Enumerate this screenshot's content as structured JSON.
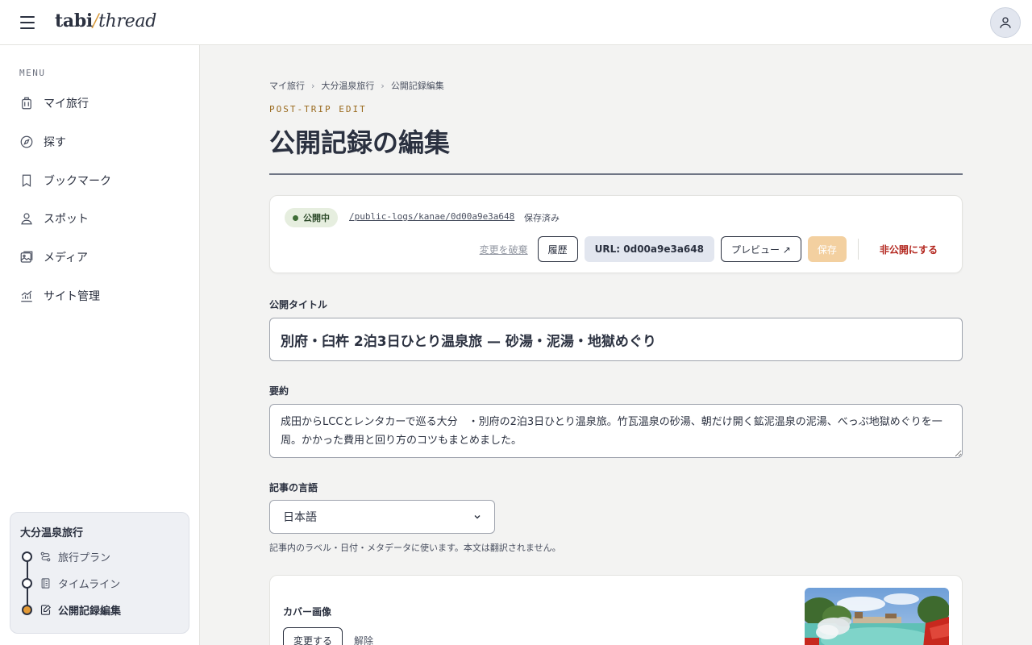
{
  "app": {
    "logo_primary": "tabi",
    "logo_slash": "/",
    "logo_secondary": "thread"
  },
  "sidebar": {
    "menu_heading": "MENU",
    "items": [
      {
        "label": "マイ旅行",
        "icon": "luggage-icon"
      },
      {
        "label": "探す",
        "icon": "compass-icon"
      },
      {
        "label": "ブックマーク",
        "icon": "bookmark-icon"
      },
      {
        "label": "スポット",
        "icon": "location-person-icon"
      },
      {
        "label": "メディア",
        "icon": "images-icon"
      },
      {
        "label": "サイト管理",
        "icon": "analytics-icon"
      }
    ],
    "trip": {
      "title": "大分温泉旅行",
      "steps": [
        {
          "label": "旅行プラン",
          "icon": "route-icon",
          "active": false
        },
        {
          "label": "タイムライン",
          "icon": "timeline-icon",
          "active": false
        },
        {
          "label": "公開記録編集",
          "icon": "edit-doc-icon",
          "active": true
        }
      ]
    }
  },
  "breadcrumb": [
    "マイ旅行",
    "大分温泉旅行",
    "公開記録編集"
  ],
  "breadcrumb_separator": "›",
  "header": {
    "eyebrow": "POST-TRIP EDIT",
    "title": "公開記録の編集"
  },
  "status": {
    "badge": "公開中",
    "url": "/public-logs/kanae/0d00a9e3a648",
    "saved_state": "保存済み",
    "discard_label": "変更を破棄",
    "history_label": "履歴",
    "url_button_label": "URL: 0d00a9e3a648",
    "preview_label": "プレビュー ↗",
    "save_label": "保存",
    "unpublish_label": "非公開にする"
  },
  "form": {
    "title_label": "公開タイトル",
    "title_value": "別府・臼杵 2泊3日ひとり温泉旅 — 砂湯・泥湯・地獄めぐり",
    "summary_label": "要約",
    "summary_value": "成田からLCCとレンタカーで巡る大分　・別府の2泊3日ひとり温泉旅。竹瓦温泉の砂湯、朝だけ開く鉱泥温泉の泥湯、べっぷ地獄めぐりを一周。かかった費用と回り方のコツもまとめました。",
    "language_label": "記事の言語",
    "language_value": "日本語",
    "language_help": "記事内のラベル・日付・メタデータに使います。本文は翻訳されません。"
  },
  "cover": {
    "label": "カバー画像",
    "change_label": "変更する",
    "remove_label": "解除"
  },
  "colors": {
    "accent": "#d99a3a",
    "ink": "#2b3140",
    "published": "#3f6d37",
    "danger": "#b3261e"
  }
}
